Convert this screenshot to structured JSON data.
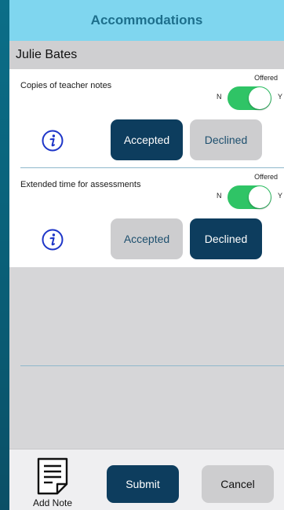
{
  "header": {
    "title": "Accommodations",
    "student_name": "Julie Bates"
  },
  "accommodations": [
    {
      "label": "Copies of teacher notes",
      "offered_label": "Offered",
      "toggle_off_label": "N",
      "toggle_on_label": "Y",
      "offered": true,
      "accept_label": "Accepted",
      "decline_label": "Declined",
      "selected": "Accepted"
    },
    {
      "label": "Extended time for assessments",
      "offered_label": "Offered",
      "toggle_off_label": "N",
      "toggle_on_label": "Y",
      "offered": true,
      "accept_label": "Accepted",
      "decline_label": "Declined",
      "selected": "Declined"
    }
  ],
  "footer": {
    "add_note_label": "Add Note",
    "submit_label": "Submit",
    "cancel_label": "Cancel"
  },
  "icons": {
    "info": "info-icon",
    "note": "note-document-icon"
  },
  "colors": {
    "header_bg": "#7fd6ef",
    "header_text": "#1d6f8c",
    "selected_button": "#0d3d5e",
    "unselected_button": "#cdcdcf",
    "toggle_on": "#2fc466",
    "info_icon": "#1d35c8"
  }
}
